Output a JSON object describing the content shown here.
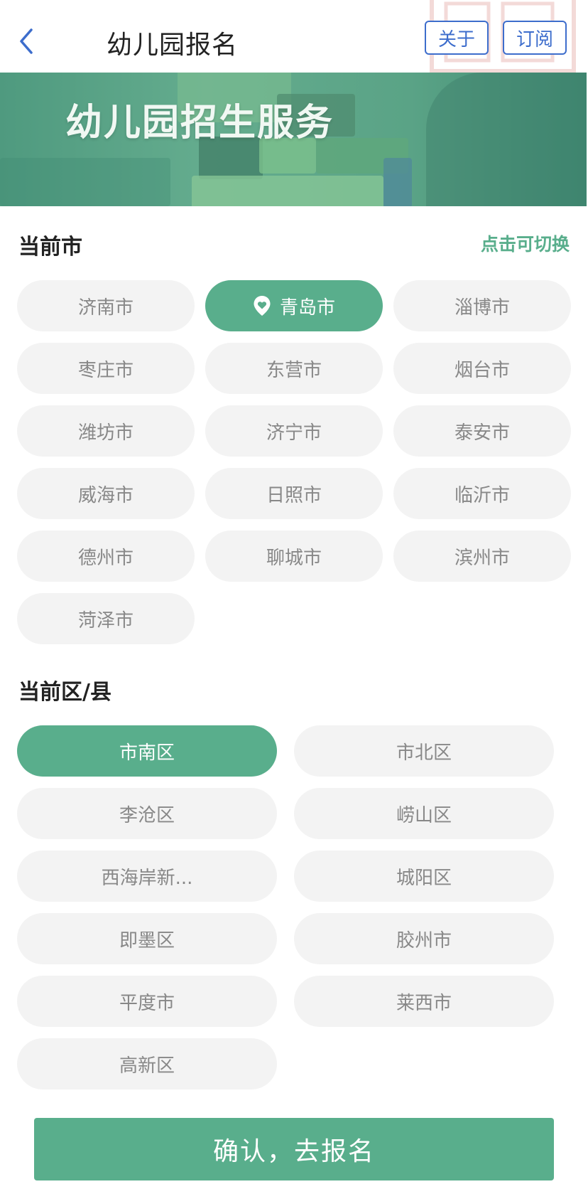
{
  "header": {
    "title": "幼儿园报名",
    "about_label": "关于",
    "subscribe_label": "订阅"
  },
  "banner": {
    "text": "幼儿园招生服务"
  },
  "city_section": {
    "title": "当前市",
    "switch_label": "点击可切换",
    "selected": "青岛市",
    "cities": [
      "济南市",
      "青岛市",
      "淄博市",
      "枣庄市",
      "东营市",
      "烟台市",
      "潍坊市",
      "济宁市",
      "泰安市",
      "威海市",
      "日照市",
      "临沂市",
      "德州市",
      "聊城市",
      "滨州市",
      "菏泽市"
    ]
  },
  "district_section": {
    "title": "当前区/县",
    "selected": "市南区",
    "districts": [
      "市南区",
      "市北区",
      "李沧区",
      "崂山区",
      "西海岸新...",
      "城阳区",
      "即墨区",
      "胶州市",
      "平度市",
      "莱西市",
      "高新区"
    ]
  },
  "confirm_label": "确认，去报名",
  "colors": {
    "accent": "#59ae8c",
    "header_button": "#3d6dcc",
    "pill_bg": "#f3f3f3",
    "pill_text": "#888888"
  }
}
